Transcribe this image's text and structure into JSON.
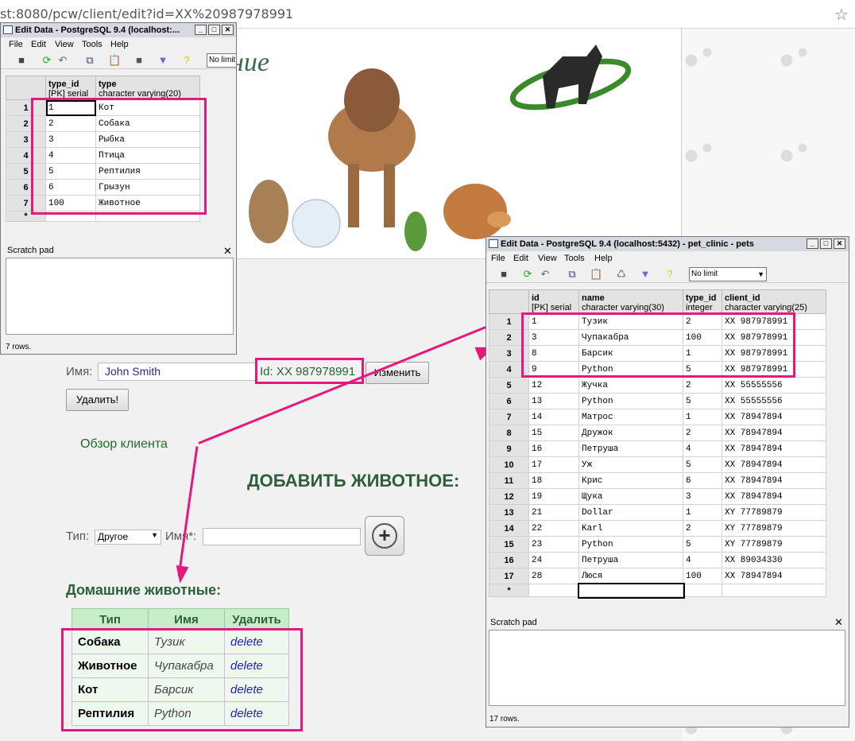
{
  "browser": {
    "url": "st:8080/pcw/client/edit?id=XX%20987978991"
  },
  "banner": {
    "title": "ние"
  },
  "form": {
    "name_label": "Имя:",
    "name_value": "John Smith",
    "id_text": "Id: XX 987978991",
    "change_btn": "Изменить",
    "delete_btn": "Удалить!",
    "client_overview": "Обзор клиента",
    "add_heading": "ДОБАВИТЬ ЖИВОТНОЕ:",
    "type_label": "Тип:",
    "type_selected": "Другое",
    "pet_name_label": "Имя*:",
    "add_icon": "plus-icon",
    "pets_heading": "Домашние животные:"
  },
  "pets_table": {
    "headers": [
      "Тип",
      "Имя",
      "Удалить"
    ],
    "rows": [
      {
        "type": "Собака",
        "name": "Тузик",
        "action": "delete"
      },
      {
        "type": "Животное",
        "name": "Чупакабра",
        "action": "delete"
      },
      {
        "type": "Кот",
        "name": "Барсик",
        "action": "delete"
      },
      {
        "type": "Рептилия",
        "name": "Python",
        "action": "delete"
      }
    ]
  },
  "win1": {
    "title": "Edit Data - PostgreSQL 9.4 (localhost:...",
    "menu": [
      "File",
      "Edit",
      "View",
      "Tools",
      "Help"
    ],
    "limit": "No limit",
    "columns": [
      {
        "name": "type_id",
        "sub": "[PK] serial"
      },
      {
        "name": "type",
        "sub": "character varying(20)"
      }
    ],
    "rows": [
      [
        "1",
        "1",
        "Кот"
      ],
      [
        "2",
        "2",
        "Собака"
      ],
      [
        "3",
        "3",
        "Рыбка"
      ],
      [
        "4",
        "4",
        "Птица"
      ],
      [
        "5",
        "5",
        "Рептилия"
      ],
      [
        "6",
        "6",
        "Грызун"
      ],
      [
        "7",
        "100",
        "Животное"
      ],
      [
        "*",
        "",
        ""
      ]
    ],
    "scratch": "Scratch pad",
    "status": "7 rows."
  },
  "win2": {
    "title": "Edit Data - PostgreSQL 9.4 (localhost:5432) - pet_clinic - pets",
    "menu": [
      "File",
      "Edit",
      "View",
      "Tools",
      "Help"
    ],
    "limit": "No limit",
    "columns": [
      {
        "name": "id",
        "sub": "[PK] serial"
      },
      {
        "name": "name",
        "sub": "character varying(30)"
      },
      {
        "name": "type_id",
        "sub": "integer"
      },
      {
        "name": "client_id",
        "sub": "character varying(25)"
      }
    ],
    "rows": [
      [
        "1",
        "1",
        "Тузик",
        "2",
        "XX 987978991"
      ],
      [
        "2",
        "3",
        "Чупакабра",
        "100",
        "XX 987978991"
      ],
      [
        "3",
        "8",
        "Барсик",
        "1",
        "XX 987978991"
      ],
      [
        "4",
        "9",
        "Python",
        "5",
        "XX 987978991"
      ],
      [
        "5",
        "12",
        "Жучка",
        "2",
        "XX 55555556"
      ],
      [
        "6",
        "13",
        "Python",
        "5",
        "XX 55555556"
      ],
      [
        "7",
        "14",
        "Матрос",
        "1",
        "XX 78947894"
      ],
      [
        "8",
        "15",
        "Дружок",
        "2",
        "XX 78947894"
      ],
      [
        "9",
        "16",
        "Петруша",
        "4",
        "XX 78947894"
      ],
      [
        "10",
        "17",
        "Уж",
        "5",
        "XX 78947894"
      ],
      [
        "11",
        "18",
        "Крис",
        "6",
        "XX 78947894"
      ],
      [
        "12",
        "19",
        "Щука",
        "3",
        "XX 78947894"
      ],
      [
        "13",
        "21",
        "Dollar",
        "1",
        "XY 77789879"
      ],
      [
        "14",
        "22",
        "Karl",
        "2",
        "XY 77789879"
      ],
      [
        "15",
        "23",
        "Python",
        "5",
        "XY 77789879"
      ],
      [
        "16",
        "24",
        "Петруша",
        "4",
        "XX 89034330"
      ],
      [
        "17",
        "28",
        "Люся",
        "100",
        "XX 78947894"
      ],
      [
        "*",
        "",
        "",
        "",
        ""
      ]
    ],
    "scratch": "Scratch pad",
    "status": "17 rows."
  },
  "colors": {
    "highlight": "#e6177d",
    "heading_green": "#2e5e3b"
  }
}
